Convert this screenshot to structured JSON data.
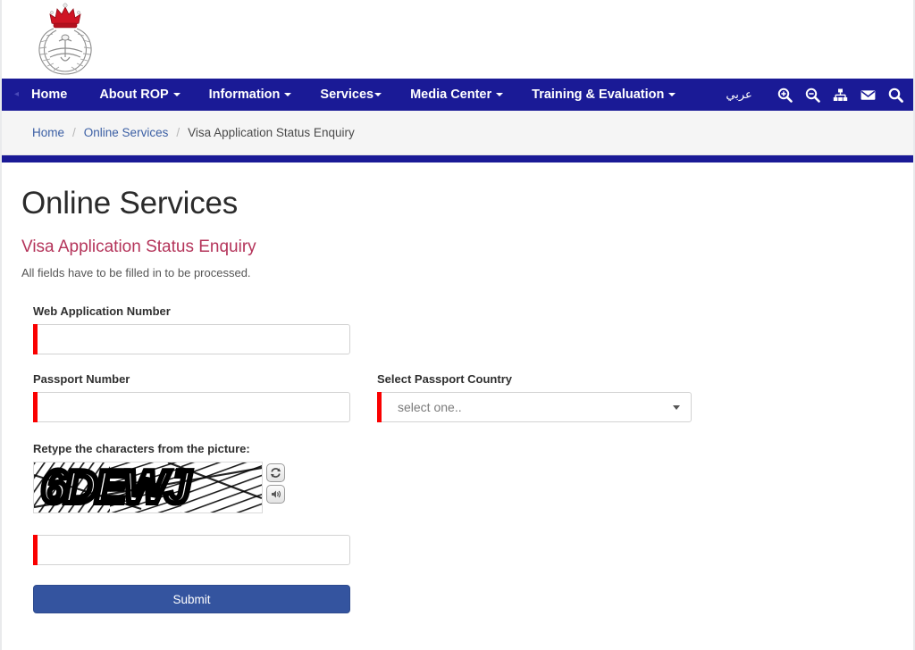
{
  "site": {
    "logo_alt": "Royal Oman Police emblem"
  },
  "nav": {
    "items": [
      {
        "label": "Home",
        "has_caret": false
      },
      {
        "label": "About ROP",
        "has_caret": true
      },
      {
        "label": "Information",
        "has_caret": true
      },
      {
        "label": "Services",
        "has_caret": true
      },
      {
        "label": "Media Center",
        "has_caret": true
      },
      {
        "label": "Training & Evaluation",
        "has_caret": true
      }
    ],
    "arabic_label": "عربي",
    "icons": [
      {
        "name": "zoom-in-icon"
      },
      {
        "name": "zoom-out-icon"
      },
      {
        "name": "sitemap-icon"
      },
      {
        "name": "envelope-icon"
      },
      {
        "name": "search-icon"
      },
      {
        "name": "rss-icon"
      }
    ]
  },
  "breadcrumb": {
    "items": [
      {
        "label": "Home",
        "current": false
      },
      {
        "label": "Online Services",
        "current": false
      },
      {
        "label": "Visa Application Status Enquiry",
        "current": true
      }
    ],
    "separator": "/"
  },
  "page": {
    "title": "Online Services",
    "subtitle": "Visa Application Status Enquiry",
    "note": "All fields have to be filled in to be processed."
  },
  "form": {
    "web_application_number": {
      "label": "Web Application Number",
      "value": "",
      "placeholder": ""
    },
    "passport_number": {
      "label": "Passport Number",
      "value": "",
      "placeholder": ""
    },
    "passport_country": {
      "label": "Select Passport Country",
      "selected": "select one..",
      "options": [
        "select one.."
      ]
    },
    "captcha": {
      "label": "Retype the characters from the picture:",
      "image_text": "6DEWJ",
      "refresh_title": "refresh-captcha",
      "audio_title": "audio-captcha",
      "value": "",
      "placeholder": ""
    },
    "submit_label": "Submit"
  },
  "colors": {
    "nav_blue": "#1a1a96",
    "accent_red": "#fa0000",
    "title_maroon": "#b4345a",
    "submit_blue": "#34549f",
    "crumb_link": "#3b5fa4"
  }
}
